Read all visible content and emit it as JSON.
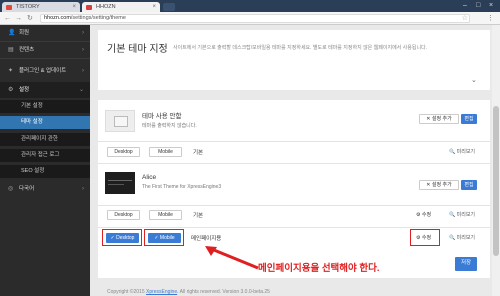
{
  "browser": {
    "tabs": [
      {
        "label": "TISTORY",
        "fav_color": "#e04a3a"
      },
      {
        "label": "HHOZN",
        "fav_color": "#d84040"
      }
    ],
    "url_host": "hhozn.com",
    "url_path": "/settings/setting/theme"
  },
  "sidebar": {
    "items": [
      {
        "label": "회원",
        "icon": "user-icon"
      },
      {
        "label": "컨텐츠",
        "icon": "content-icon"
      },
      {
        "label": "플러그인 & 업데이트",
        "icon": "plugin-icon"
      },
      {
        "label": "설정",
        "icon": "settings-icon"
      }
    ],
    "sub_items": [
      "기본 설정",
      "테마 설정",
      "관리페이지 관한",
      "관리자 접근 로그",
      "SEO 설정"
    ],
    "extra": {
      "label": "다국어",
      "icon": "globe-icon"
    }
  },
  "header": {
    "title": "기본 테마 지정",
    "description": "사이트에서 기본으로 출력할 데스크탑/모바일용 테마를 지정하세요. 별도로 테마를 지정하지 않은 웹페이지에서 사용됩니다."
  },
  "theme_guide": {
    "title": "테마 사용 안함",
    "subtitle": "테마를 출력하지 않습니다.",
    "settings_label": "설정 추가",
    "edit_label": "편집"
  },
  "row_default": {
    "desktop": "Desktop",
    "mobile": "Mobile",
    "label": "기본",
    "preview": "미리보기"
  },
  "alice": {
    "title": "Alice",
    "subtitle": "The First Theme for XpressEngine3",
    "settings_label": "설정 추가",
    "edit_label": "편집",
    "desktop": "Desktop",
    "mobile": "Mobile",
    "label": "기본",
    "modify": "수정",
    "preview": "미리보기"
  },
  "row_main": {
    "desktop": "✓ Desktop",
    "mobile": "✓ Mobile",
    "label": "메인페이지용",
    "modify": "수정",
    "preview": "미리보기"
  },
  "annotation": "메인페이지용을 선택해야 한다.",
  "save_label": "저장",
  "footer": {
    "prefix": "Copyright ©2015 ",
    "link": "XpressEngine",
    "suffix": ". All rights reserved. Version 3.0.0-beta.25"
  },
  "colors": {
    "accent": "#3a7bd5",
    "annotation": "#e02020"
  }
}
